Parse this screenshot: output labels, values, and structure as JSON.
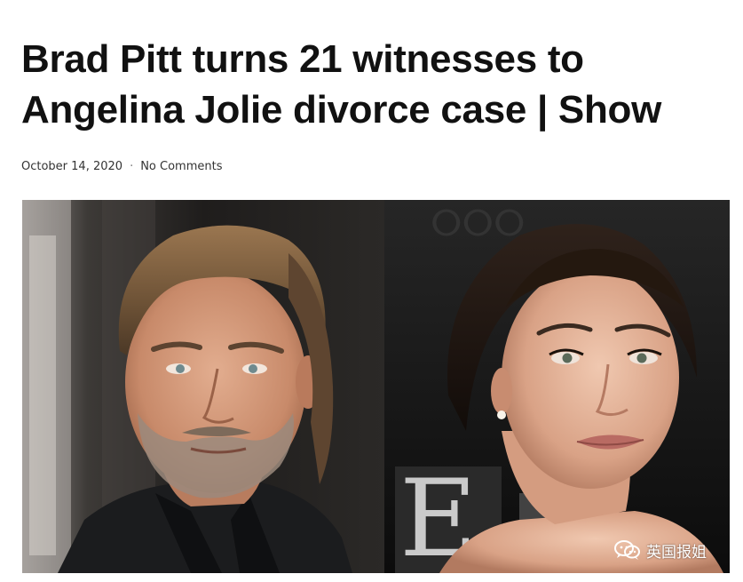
{
  "article": {
    "title": "Brad Pitt turns 21 witnesses to Angelina Jolie divorce case | Show",
    "date": "October 14, 2020",
    "separator": "·",
    "comments_label": "No Comments"
  },
  "image": {
    "left_subject": "brad-pitt-portrait",
    "right_subject": "angelina-jolie-portrait"
  },
  "watermark": {
    "icon": "wechat-icon",
    "text": "英国报姐"
  },
  "colors": {
    "headline": "#111111",
    "meta": "#333333",
    "watermark": "#ffffff"
  }
}
